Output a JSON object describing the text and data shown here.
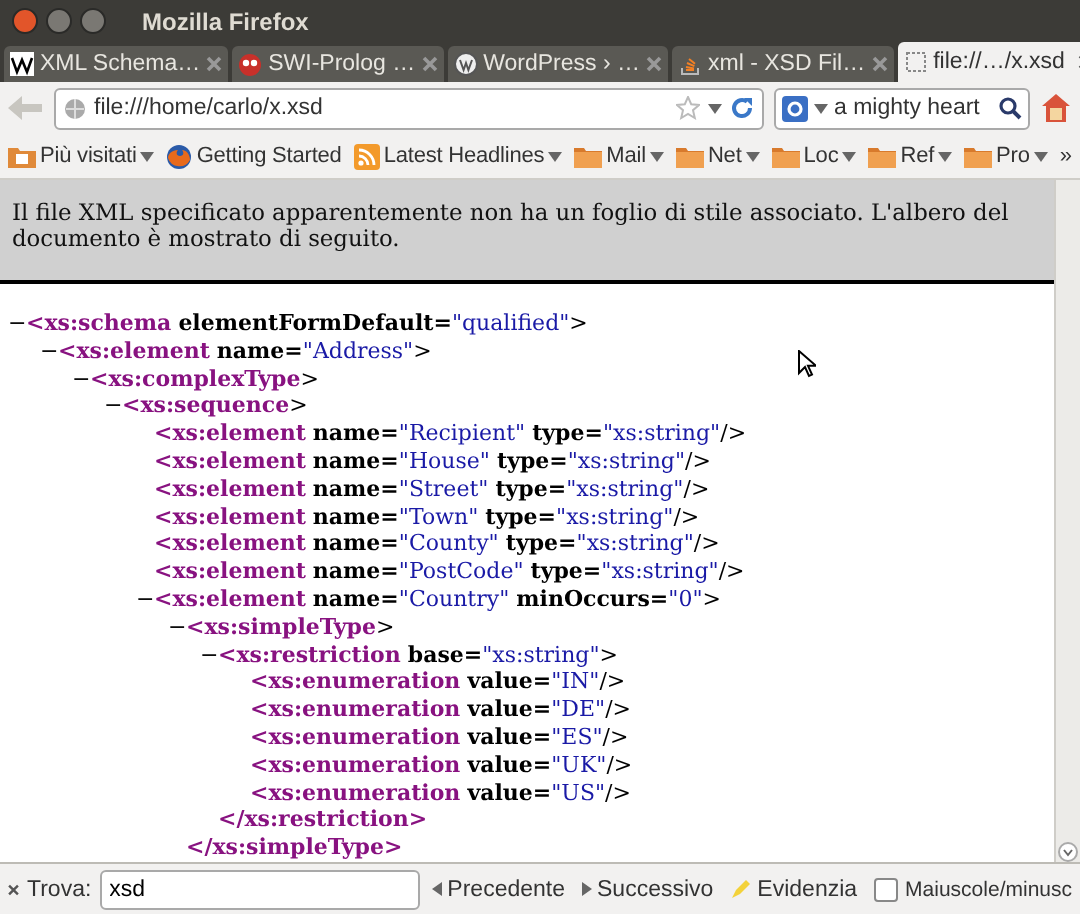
{
  "window": {
    "title": "Mozilla Firefox"
  },
  "tabs": [
    {
      "label": "XML Schema…",
      "selected": false
    },
    {
      "label": "SWI-Prolog …",
      "selected": false
    },
    {
      "label": "WordPress › …",
      "selected": false
    },
    {
      "label": "xml - XSD Fil…",
      "selected": false
    },
    {
      "label": "file://…/x.xsd",
      "selected": true
    }
  ],
  "address_bar": {
    "value": "file:///home/carlo/x.xsd"
  },
  "search": {
    "value": "a mighty heart"
  },
  "bookmarks": [
    {
      "label": "Più visitati",
      "menu": true
    },
    {
      "label": "Getting Started",
      "menu": false
    },
    {
      "label": "Latest Headlines",
      "menu": true
    },
    {
      "label": "Mail",
      "menu": true
    },
    {
      "label": "Net",
      "menu": true
    },
    {
      "label": "Loc",
      "menu": true
    },
    {
      "label": "Ref",
      "menu": true
    },
    {
      "label": "Pro",
      "menu": true
    }
  ],
  "bookmarks_overflow": "»",
  "notice": "Il file XML specificato apparentemente non ha un foglio di stile associato. L'albero del documento è mostrato di seguito.",
  "xml_tree": [
    {
      "toggle": "−",
      "tag": "<xs:schema",
      "attrs": [
        {
          "name": "elementFormDefault=",
          "value": "\"qualified\""
        }
      ],
      "end": ">",
      "children": [
        {
          "toggle": "−",
          "tag": "<xs:element",
          "attrs": [
            {
              "name": "name=",
              "value": "\"Address\""
            }
          ],
          "end": ">",
          "children": [
            {
              "toggle": "−",
              "tag": "<xs:complexType",
              "end": ">",
              "children": [
                {
                  "toggle": "−",
                  "tag": "<xs:sequence",
                  "end": ">",
                  "children": [
                    {
                      "tag": "<xs:element",
                      "attrs": [
                        {
                          "name": "name=",
                          "value": "\"Recipient\""
                        },
                        {
                          "name": "type=",
                          "value": "\"xs:string\""
                        }
                      ],
                      "end": "/>"
                    },
                    {
                      "tag": "<xs:element",
                      "attrs": [
                        {
                          "name": "name=",
                          "value": "\"House\""
                        },
                        {
                          "name": "type=",
                          "value": "\"xs:string\""
                        }
                      ],
                      "end": "/>"
                    },
                    {
                      "tag": "<xs:element",
                      "attrs": [
                        {
                          "name": "name=",
                          "value": "\"Street\""
                        },
                        {
                          "name": "type=",
                          "value": "\"xs:string\""
                        }
                      ],
                      "end": "/>"
                    },
                    {
                      "tag": "<xs:element",
                      "attrs": [
                        {
                          "name": "name=",
                          "value": "\"Town\""
                        },
                        {
                          "name": "type=",
                          "value": "\"xs:string\""
                        }
                      ],
                      "end": "/>"
                    },
                    {
                      "tag": "<xs:element",
                      "attrs": [
                        {
                          "name": "name=",
                          "value": "\"County\""
                        },
                        {
                          "name": "type=",
                          "value": "\"xs:string\""
                        }
                      ],
                      "end": "/>"
                    },
                    {
                      "tag": "<xs:element",
                      "attrs": [
                        {
                          "name": "name=",
                          "value": "\"PostCode\""
                        },
                        {
                          "name": "type=",
                          "value": "\"xs:string\""
                        }
                      ],
                      "end": "/>"
                    },
                    {
                      "toggle": "−",
                      "tag": "<xs:element",
                      "attrs": [
                        {
                          "name": "name=",
                          "value": "\"Country\""
                        },
                        {
                          "name": "minOccurs=",
                          "value": "\"0\""
                        }
                      ],
                      "end": ">",
                      "children": [
                        {
                          "toggle": "−",
                          "tag": "<xs:simpleType",
                          "end": ">",
                          "children": [
                            {
                              "toggle": "−",
                              "tag": "<xs:restriction",
                              "attrs": [
                                {
                                  "name": "base=",
                                  "value": "\"xs:string\""
                                }
                              ],
                              "end": ">",
                              "children": [
                                {
                                  "tag": "<xs:enumeration",
                                  "attrs": [
                                    {
                                      "name": "value=",
                                      "value": "\"IN\""
                                    }
                                  ],
                                  "end": "/>"
                                },
                                {
                                  "tag": "<xs:enumeration",
                                  "attrs": [
                                    {
                                      "name": "value=",
                                      "value": "\"DE\""
                                    }
                                  ],
                                  "end": "/>"
                                },
                                {
                                  "tag": "<xs:enumeration",
                                  "attrs": [
                                    {
                                      "name": "value=",
                                      "value": "\"ES\""
                                    }
                                  ],
                                  "end": "/>"
                                },
                                {
                                  "tag": "<xs:enumeration",
                                  "attrs": [
                                    {
                                      "name": "value=",
                                      "value": "\"UK\""
                                    }
                                  ],
                                  "end": "/>"
                                },
                                {
                                  "tag": "<xs:enumeration",
                                  "attrs": [
                                    {
                                      "name": "value=",
                                      "value": "\"US\""
                                    }
                                  ],
                                  "end": "/>"
                                }
                              ],
                              "close": "</xs:restriction>"
                            }
                          ],
                          "close": "</xs:simpleType>"
                        }
                      ]
                    }
                  ]
                }
              ]
            }
          ]
        }
      ]
    }
  ],
  "find_bar": {
    "label": "Trova:",
    "value": "xsd",
    "previous": "Precedente",
    "next": "Successivo",
    "highlight": "Evidenzia",
    "match_case": {
      "label": "Maiuscole/minusc",
      "checked": false
    }
  }
}
